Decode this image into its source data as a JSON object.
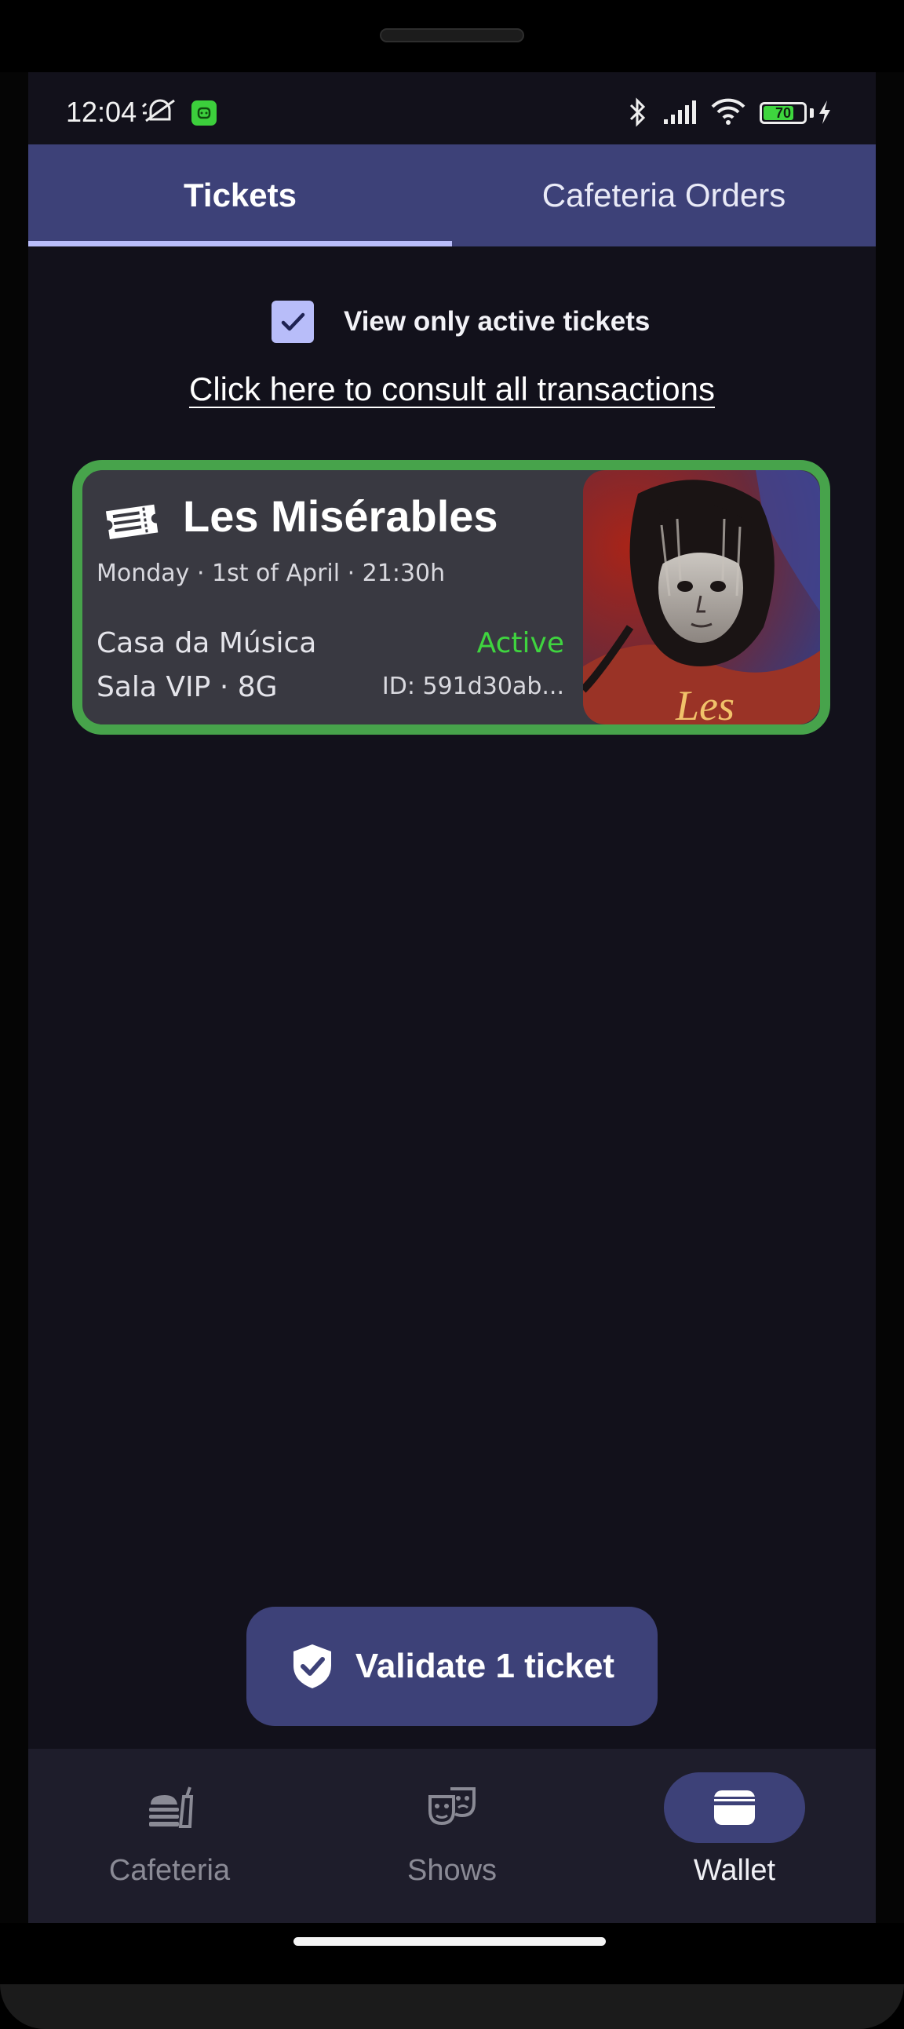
{
  "status_bar": {
    "time": "12:04",
    "battery_level": "70",
    "icons": [
      "mute-alarm-icon",
      "android-app-icon",
      "bluetooth-icon",
      "signal-icon",
      "wifi-icon",
      "battery-icon",
      "charging-icon"
    ]
  },
  "tabs": [
    {
      "label": "Tickets",
      "active": true
    },
    {
      "label": "Cafeteria Orders",
      "active": false
    }
  ],
  "filter": {
    "label": "View only active tickets",
    "checked": true
  },
  "transactions_link": "Click here to consult all transactions",
  "tickets": [
    {
      "title": "Les Misérables",
      "date": "Monday · 1st of April · 21:30h",
      "venue": "Casa da Música",
      "seat": "Sala VIP · 8G",
      "status": "Active",
      "id": "ID: 591d30ab...",
      "poster_text": "Les"
    }
  ],
  "validate_button": {
    "label": "Validate 1 ticket",
    "icon": "shield-check-icon"
  },
  "bottom_nav": [
    {
      "label": "Cafeteria",
      "icon": "cafeteria-icon",
      "active": false
    },
    {
      "label": "Shows",
      "icon": "theater-masks-icon",
      "active": false
    },
    {
      "label": "Wallet",
      "icon": "wallet-icon",
      "active": true
    }
  ],
  "colors": {
    "background": "#12111b",
    "accent": "#3d4178",
    "tab_indicator": "#b9bdfb",
    "card_border": "#47a34b",
    "card_background": "#393941",
    "status_active": "#3fd43f"
  }
}
